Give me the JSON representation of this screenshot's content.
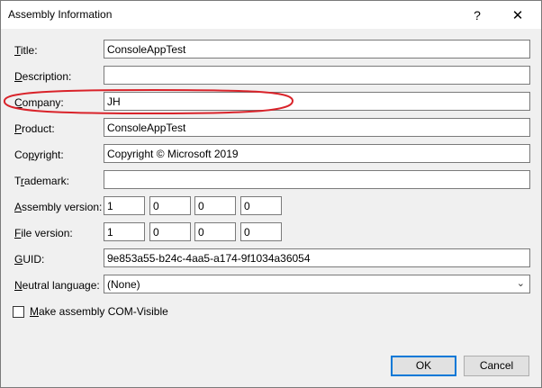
{
  "window": {
    "title": "Assembly Information"
  },
  "titlebar": {
    "help_glyph": "?",
    "close_glyph": "✕"
  },
  "fields": {
    "title": {
      "label_key": "T",
      "label_rest": "itle:",
      "value": "ConsoleAppTest"
    },
    "description": {
      "label_key": "D",
      "label_rest": "escription:",
      "value": ""
    },
    "company": {
      "label_key": "C",
      "label_rest": "ompany:",
      "value": "JH"
    },
    "product": {
      "label_key": "P",
      "label_rest": "roduct:",
      "value": "ConsoleAppTest"
    },
    "copyright": {
      "label_pre": "Co",
      "label_key": "p",
      "label_rest": "yright:",
      "value": "Copyright © Microsoft 2019"
    },
    "trademark": {
      "label_pre": "T",
      "label_key": "r",
      "label_rest": "ademark:",
      "value": ""
    },
    "assembly_version": {
      "label_key": "A",
      "label_rest": "ssembly version:",
      "values": [
        "1",
        "0",
        "0",
        "0"
      ]
    },
    "file_version": {
      "label_key": "F",
      "label_rest": "ile version:",
      "values": [
        "1",
        "0",
        "0",
        "0"
      ]
    },
    "guid": {
      "label_key": "G",
      "label_rest": "UID:",
      "value": "9e853a55-b24c-4aa5-a174-9f1034a36054"
    },
    "neutral_language": {
      "label_key": "N",
      "label_rest": "eutral language:",
      "value": "(None)"
    }
  },
  "com_visible": {
    "label_key": "M",
    "label_rest": "ake assembly COM-Visible",
    "checked": false
  },
  "buttons": {
    "ok": "OK",
    "cancel": "Cancel"
  },
  "colors": {
    "accent": "#0078d7",
    "annotation": "#d9232a"
  }
}
